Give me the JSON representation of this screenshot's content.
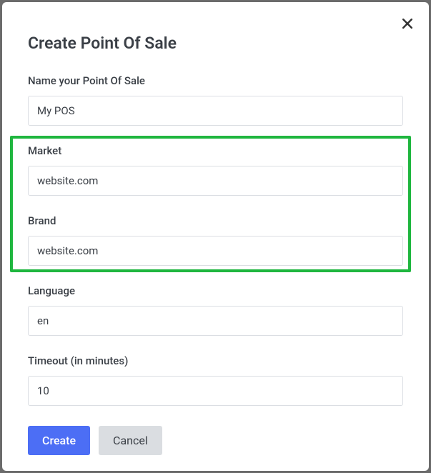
{
  "modal": {
    "title": "Create Point Of Sale",
    "fields": {
      "name": {
        "label": "Name your Point Of Sale",
        "value": "My POS"
      },
      "market": {
        "label": "Market",
        "value": "website.com"
      },
      "brand": {
        "label": "Brand",
        "value": "website.com"
      },
      "language": {
        "label": "Language",
        "value": "en"
      },
      "timeout": {
        "label": "Timeout (in minutes)",
        "value": "10"
      }
    },
    "buttons": {
      "create": "Create",
      "cancel": "Cancel"
    }
  }
}
